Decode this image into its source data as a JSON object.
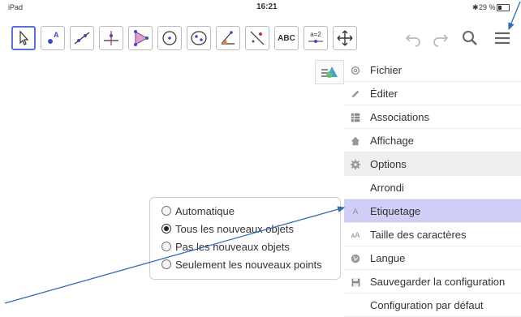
{
  "status_bar": {
    "device": "iPad",
    "time": "16:21",
    "bluetooth": "✱",
    "battery": "29 %"
  },
  "toolbar": {
    "tools": [
      {
        "name": "move-tool",
        "icon": "cursor-arrow"
      },
      {
        "name": "point-tool",
        "icon": "point-A"
      },
      {
        "name": "line-tool",
        "icon": "line-through-points"
      },
      {
        "name": "perpendicular-tool",
        "icon": "perpendicular-lines"
      },
      {
        "name": "polygon-tool",
        "icon": "polygon"
      },
      {
        "name": "circle-tool",
        "icon": "circle-center-point"
      },
      {
        "name": "ellipse-tool",
        "icon": "ellipse"
      },
      {
        "name": "angle-tool",
        "icon": "angle"
      },
      {
        "name": "reflect-tool",
        "icon": "reflect-about-line"
      },
      {
        "name": "text-tool",
        "icon": "text",
        "label": "ABC"
      },
      {
        "name": "slider-tool",
        "icon": "slider",
        "label": "a=2"
      },
      {
        "name": "move-graphics-tool",
        "icon": "four-arrows"
      }
    ],
    "undo_icon": "undo-arrow",
    "redo_icon": "redo-arrow",
    "search_icon": "magnifier",
    "menu_icon": "hamburger"
  },
  "menu": {
    "items": [
      {
        "label": "Fichier",
        "icon": "gear-outline"
      },
      {
        "label": "Éditer",
        "icon": "pencil"
      },
      {
        "label": "Associations",
        "icon": "table-grid"
      },
      {
        "label": "Affichage",
        "icon": "house"
      },
      {
        "label": "Options",
        "icon": "gear"
      },
      {
        "label": "Arrondi",
        "icon": ""
      },
      {
        "label": "Etiquetage",
        "icon": "label-A"
      },
      {
        "label": "Taille des caractères",
        "icon": "font-size-AA"
      },
      {
        "label": "Langue",
        "icon": "globe"
      },
      {
        "label": "Sauvegarder la configuration",
        "icon": "floppy-disk"
      },
      {
        "label": "Configuration par défaut",
        "icon": ""
      }
    ]
  },
  "labeling_popup": {
    "options": [
      {
        "label": "Automatique",
        "selected": false
      },
      {
        "label": "Tous les nouveaux objets",
        "selected": true
      },
      {
        "label": "Pas les nouveaux objets",
        "selected": false
      },
      {
        "label": "Seulement les nouveaux points",
        "selected": false
      }
    ]
  },
  "colors": {
    "accent": "#5a6ee3",
    "highlight": "#d0cdf7",
    "arrow": "#2f6fb4"
  }
}
